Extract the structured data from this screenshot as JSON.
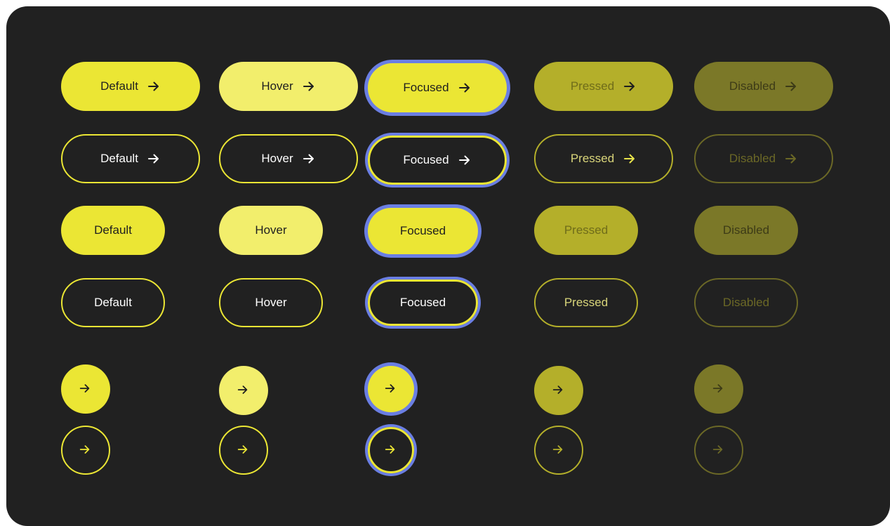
{
  "colors": {
    "panel_bg": "#212121",
    "accent_default": "#ebe634",
    "accent_hover": "#f2ee6c",
    "accent_pressed": "#b4af2a",
    "accent_disabled": "#7b7828",
    "focus_ring": "#6a7ee3"
  },
  "icons": {
    "arrow": "arrow-right-icon"
  },
  "rows": {
    "filled_arrow": [
      "Default",
      "Hover",
      "Focused",
      "Pressed",
      "Disabled"
    ],
    "outline_arrow": [
      "Default",
      "Hover",
      "Focused",
      "Pressed",
      "Disabled"
    ],
    "filled_plain": [
      "Default",
      "Hover",
      "Focused",
      "Pressed",
      "Disabled"
    ],
    "outline_plain": [
      "Default",
      "Hover",
      "Focused",
      "Pressed",
      "Disabled"
    ]
  }
}
